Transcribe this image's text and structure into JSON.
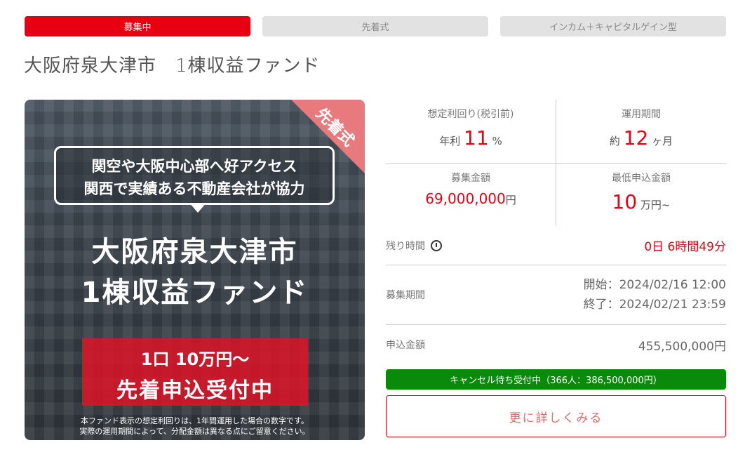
{
  "tags": [
    "募集中",
    "先着式",
    "インカム＋キャピタルゲイン型"
  ],
  "fund_title": "大阪府泉大津市　1棟収益ファンド",
  "hero": {
    "corner_badge": "先着式",
    "bubble_line1": "関空や大阪中心部へ好アクセス",
    "bubble_line2": "関西で実績ある不動産会社が協力",
    "title_line1": "大阪府泉大津市",
    "title_line2": "1棟収益ファンド",
    "unit_line": "1口 10万円～",
    "status_line": "先着申込受付中",
    "note_line1": "本ファンド表示の想定利回りは、1年間運用した場合の数字です。",
    "note_line2": "実際の運用期間によって、分配金額は異なる点にご留意ください。"
  },
  "stats": {
    "yield": {
      "label": "想定利回り(税引前)",
      "prefix": "年利",
      "value": "11",
      "suffix": "%"
    },
    "period": {
      "label": "運用期間",
      "prefix": "約",
      "value": "12",
      "suffix": "ヶ月"
    },
    "amount": {
      "label": "募集金額",
      "value": "69,000,000",
      "suffix": "円"
    },
    "min": {
      "label": "最低申込金額",
      "value": "10",
      "suffix": "万円~"
    }
  },
  "remaining": {
    "label": "残り時間",
    "value": "0日 6時間49分"
  },
  "recruit_period": {
    "label": "募集期間",
    "start": "開始：2024/02/16 12:00",
    "end": "終了：2024/02/21 23:59"
  },
  "applied": {
    "label": "申込金額",
    "value": "455,500,000円"
  },
  "cancel_wait": "キャンセル待ち受付中（366人：386,500,000円）",
  "more_button": "更に詳しくみる"
}
